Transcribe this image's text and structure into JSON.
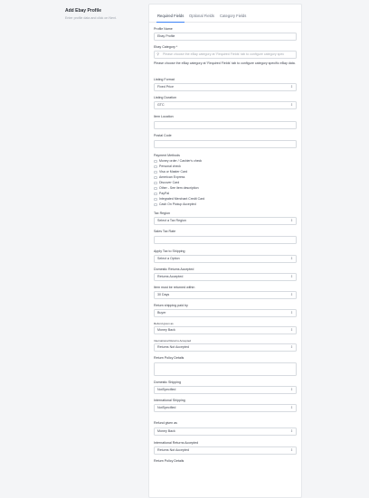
{
  "sidebar": {
    "title": "Add Ebay Profile",
    "subtitle": "Enter profile data and click on Next."
  },
  "tabs": [
    {
      "label": "Required Fields",
      "active": true
    },
    {
      "label": "Optional Fields",
      "active": false
    },
    {
      "label": "Category Fields",
      "active": false
    }
  ],
  "form": {
    "profile_name": {
      "label": "Profile Name",
      "value": "Ebay Profile"
    },
    "ebay_category": {
      "label": "Ebay Category *",
      "placeholder": "Please choose the eBay category at 'Required Fields' tab to configure category spec"
    },
    "category_note": "Please choose the eBay category at 'Required Fields' tab to configure category specific eBay data.",
    "listing_format": {
      "label": "Listing Format",
      "value": "Fixed Price"
    },
    "listing_duration": {
      "label": "Listing Duration",
      "value": "GTC"
    },
    "item_location": {
      "label": "Item Location",
      "value": ""
    },
    "postal_code": {
      "label": "Postal Code",
      "value": ""
    },
    "payment_methods": {
      "label": "Payment Methods",
      "options": [
        "Money order / Cashier's check",
        "Personal check",
        "Visa or Master Card",
        "American Express",
        "Discover Card",
        "Other - See item description",
        "PayPal",
        "Integrated Merchant Credit Card",
        "Cash On Pickup Accepted"
      ]
    },
    "tax_region": {
      "label": "Tax Region",
      "value": "Select a Tax Region"
    },
    "sales_tax_rate": {
      "label": "Sales Tax Rate",
      "value": ""
    },
    "apply_tax_shipping": {
      "label": "Apply Tax to Shipping",
      "value": "Select a Option"
    },
    "domestic_returns": {
      "label": "Domestic Returns Accepted",
      "value": "Returns Accepted"
    },
    "return_within": {
      "label": "Item must be returned within",
      "value": "30 Days"
    },
    "return_shipping_paid": {
      "label": "Return shipping paid by",
      "value": "Buyer"
    },
    "refund_given_as_1": {
      "label": "Refund given as",
      "value": "Money Back"
    },
    "intl_returns_1": {
      "label": "International Returns Accepted",
      "value": "Returns Not Accepted"
    },
    "return_policy_1": {
      "label": "Return Policy Details",
      "value": ""
    },
    "domestic_shipping": {
      "label": "Domestic Shipping",
      "value": "NotSpecified"
    },
    "intl_shipping": {
      "label": "International Shipping",
      "value": "NotSpecified"
    },
    "refund_given_as_2": {
      "label": "Refund given as",
      "value": "Money Back"
    },
    "intl_returns_2": {
      "label": "International Returns Accepted",
      "value": "Returns Not Accepted"
    },
    "return_policy_2": {
      "label": "Return Policy Details"
    }
  }
}
